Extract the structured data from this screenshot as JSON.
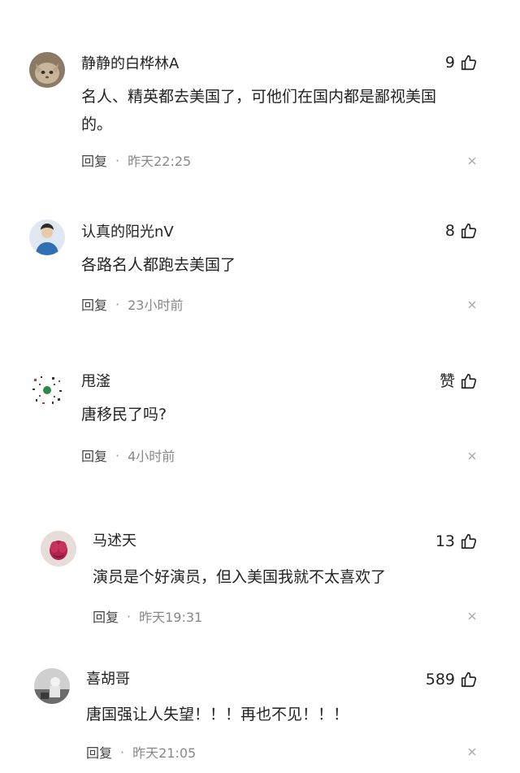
{
  "comments": [
    {
      "username": "静静的白桦林A",
      "likes": "9",
      "text": "名人、精英都去美国了，可他们在国内都是鄙视美国\n的。",
      "reply_label": "回复",
      "separator": "·",
      "time": "昨天22:25",
      "avatar_icon": "cat-avatar-icon"
    },
    {
      "username": "认真的阳光nV",
      "likes": "8",
      "text": "各路名人都跑去美国了",
      "reply_label": "回复",
      "separator": "·",
      "time": "23小时前",
      "avatar_icon": "person-avatar-icon"
    },
    {
      "username": "甩滏",
      "likes": "赞",
      "text": "唐移民了吗?",
      "reply_label": "回复",
      "separator": "·",
      "time": "4小时前",
      "avatar_icon": "qr-pattern-avatar-icon"
    },
    {
      "username": "马述天",
      "likes": "13",
      "text": "演员是个好演员，但入美国我就不太喜欢了",
      "reply_label": "回复",
      "separator": "·",
      "time": "昨天19:31",
      "avatar_icon": "flower-avatar-icon"
    },
    {
      "username": "喜胡哥",
      "likes": "589",
      "text": "唐国强让人失望！！！再也不见！！！",
      "reply_label": "回复",
      "separator": "·",
      "time": "昨天21:05",
      "avatar_icon": "photo-avatar-icon"
    }
  ],
  "icons": {
    "like": "thumbs-up-icon",
    "dismiss": "close-icon"
  },
  "colors": {
    "text": "#222222",
    "meta": "#888888",
    "background": "#ffffff"
  }
}
